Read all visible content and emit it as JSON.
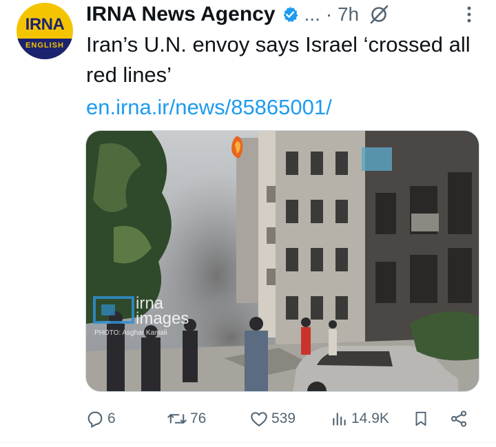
{
  "account": {
    "name": "IRNA News Agency",
    "avatar_top": "IRNA",
    "avatar_bottom": "ENGLISH",
    "handle_ellipsis": "...",
    "time": "· 7h"
  },
  "tweet": {
    "text": "Iran’s U.N. envoy says Israel ‘crossed all red lines’",
    "link": "en.irna.ir/news/85865001/"
  },
  "media": {
    "watermark_brand": "irna",
    "watermark_sub": "images",
    "watermark_credit": "PHOTO: Asghar Kamali"
  },
  "actions": {
    "replies": "6",
    "retweets": "76",
    "likes": "539",
    "views": "14.9K"
  },
  "colors": {
    "link": "#1d9bf0",
    "verified": "#1d9bf0",
    "muted": "#536471",
    "avatar_bg": "#f5c400",
    "avatar_navy": "#1b2270"
  }
}
